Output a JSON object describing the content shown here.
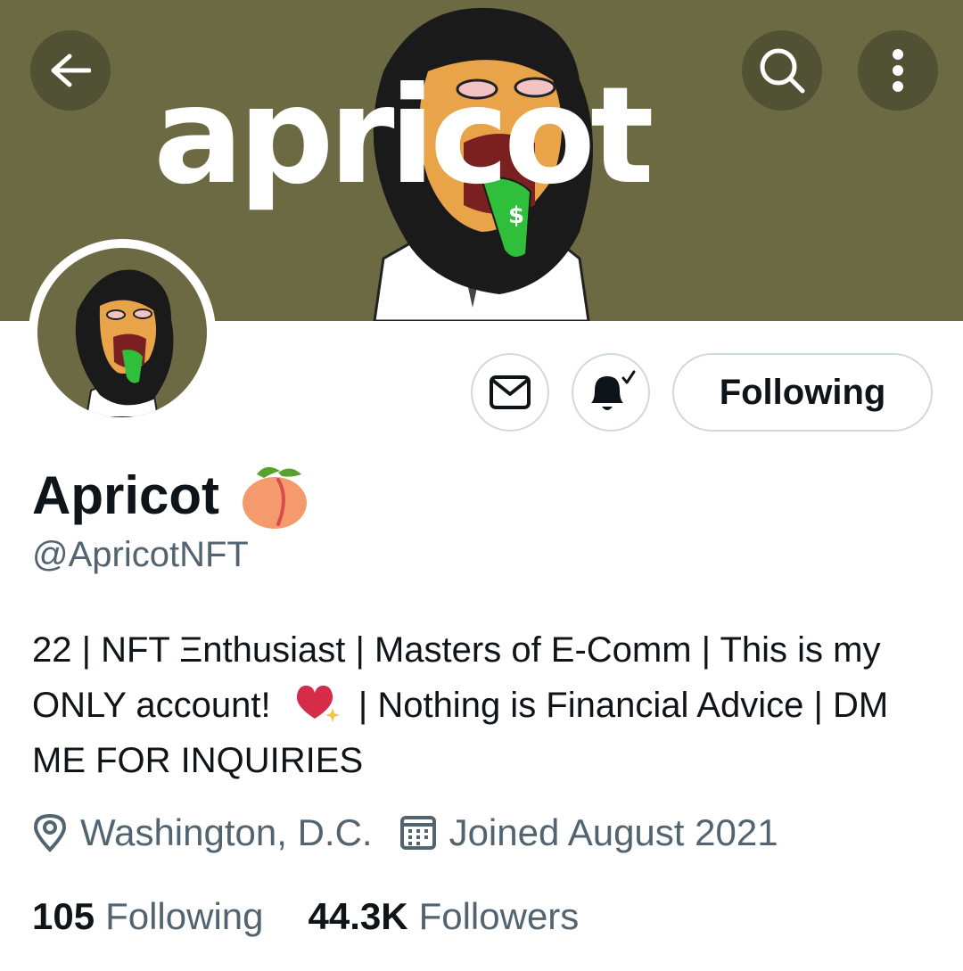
{
  "header": {
    "banner_text": "apricot",
    "banner_color": "#6b6a42",
    "back_icon": "back-arrow-icon",
    "search_icon": "search-icon",
    "more_icon": "more-vertical-icon"
  },
  "profile": {
    "avatar": "lion-avatar",
    "message_icon": "envelope-icon",
    "notify_icon": "bell-check-icon",
    "follow_button_label": "Following",
    "display_name": "Apricot",
    "name_emoji": "peach-emoji",
    "handle": "@ApricotNFT",
    "bio_part1": "22 | NFT Ξnthusiast | Masters of E-Comm | This is my ONLY account!",
    "bio_emoji": "sparkling-heart-emoji",
    "bio_part2": "| Nothing is Financial Advice | DM ME FOR INQUIRIES",
    "location": "Washington, D.C.",
    "joined": "Joined August 2021",
    "following_count": "105",
    "following_label": "Following",
    "followers_count": "44.3K",
    "followers_label": "Followers"
  },
  "colors": {
    "text_primary": "#0f1419",
    "text_secondary": "#536471",
    "border": "#cfd9de"
  }
}
